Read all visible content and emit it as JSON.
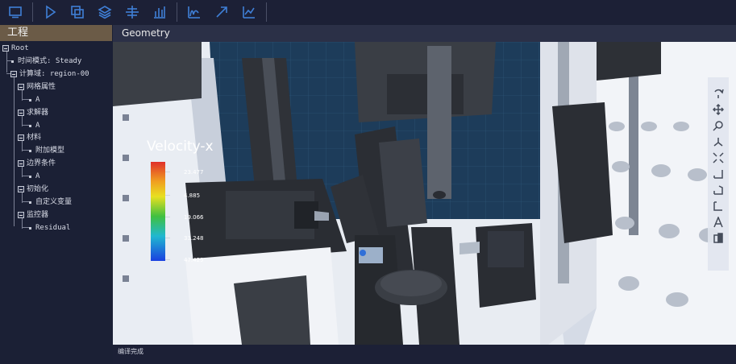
{
  "toolbar": {
    "buttons": [
      "monitor-icon",
      "play-icon",
      "copy-icon",
      "layers-icon",
      "align-icon",
      "bar-chart-icon",
      "curve-icon",
      "arrow-icon",
      "line-chart-icon"
    ]
  },
  "left_panel": {
    "title": "工程",
    "tree": {
      "root": "Root",
      "time_mode": "时间模式: Steady",
      "region": "计算域: region-00",
      "mesh": "网格属性",
      "mesh_child": "A",
      "solver": "求解器",
      "solver_child": "A",
      "material": "材料",
      "material_child": "附加模型",
      "boundary": "边界条件",
      "boundary_child": "A",
      "init": "初始化",
      "init_child": "自定义变量",
      "monitor": "监控器",
      "monitor_child": "Residual"
    }
  },
  "viewport": {
    "title": "Geometry",
    "legend": {
      "title": "Velocity-x",
      "labels": [
        "23.477",
        "4.885",
        "19.066",
        "33.248",
        "47.429"
      ]
    }
  },
  "status": {
    "text": "编译完成"
  },
  "colors": {
    "accent": "#3f7fd6",
    "panel_header": "#6b5b47",
    "background": "#1b2035"
  }
}
